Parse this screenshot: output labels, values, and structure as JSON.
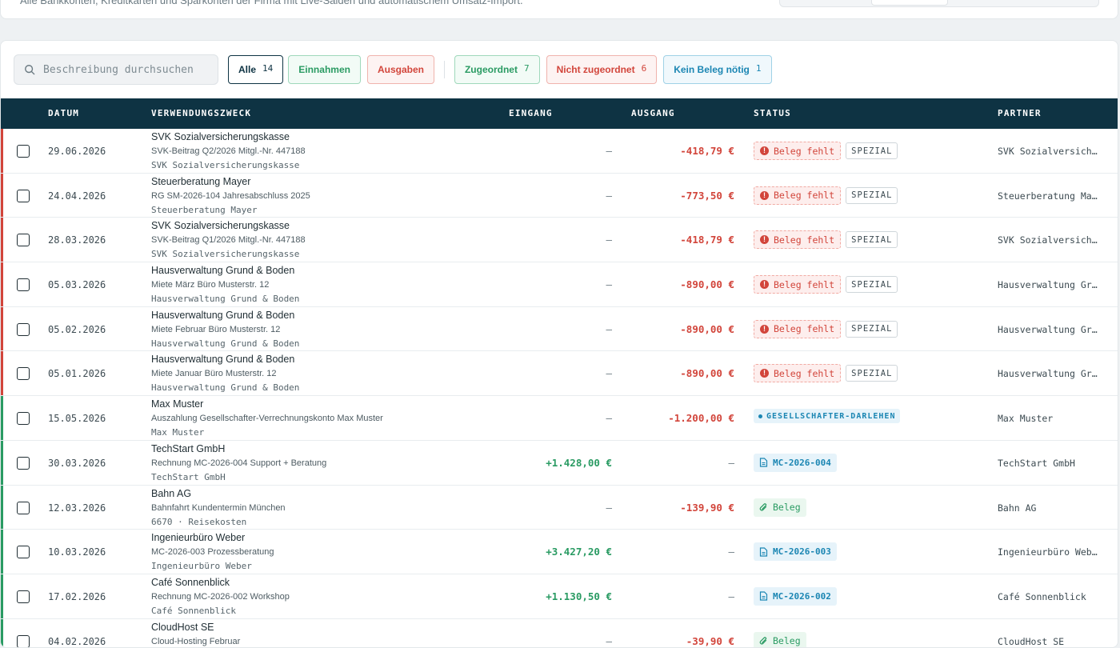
{
  "top": {
    "subtitle": "Alle Bankkonten, Kreditkarten und Sparkonten der Firma mit Live-Salden und automatischem Umsatz-Import."
  },
  "search": {
    "placeholder": "Beschreibung durchsuchen"
  },
  "filters": {
    "all": {
      "label": "Alle",
      "count": "14"
    },
    "income": {
      "label": "Einnahmen"
    },
    "expenses": {
      "label": "Ausgaben"
    },
    "assigned": {
      "label": "Zugeordnet",
      "count": "7"
    },
    "unassigned": {
      "label": "Nicht zugeordnet",
      "count": "6"
    },
    "no_receipt": {
      "label": "Kein Beleg nötig",
      "count": "1"
    }
  },
  "columns": {
    "date": "DATUM",
    "purpose": "VERWENDUNGSZWECK",
    "income": "EINGANG",
    "expense": "AUSGANG",
    "status": "STATUS",
    "partner": "PARTNER"
  },
  "colors": {
    "header_bg": "#0e3343",
    "positive": "#2a9b63",
    "negative": "#d2453b",
    "info": "#1b86b3"
  },
  "rows": [
    {
      "indicator": "red",
      "date": "29.06.2026",
      "title": "SVK Sozialversicherungskasse",
      "detail": "SVK-Beitrag Q2/2026 Mitgl.-Nr. 447188",
      "sub": "SVK Sozialversicherungskasse",
      "income": "–",
      "expense": "-418,79 €",
      "status": "missing",
      "status_label": "Beleg fehlt",
      "tag": "SPEZIAL",
      "partner": "SVK Sozialversicherungskasse"
    },
    {
      "indicator": "red",
      "date": "24.04.2026",
      "title": "Steuerberatung Mayer",
      "detail": "RG SM-2026-104 Jahresabschluss 2025",
      "sub": "Steuerberatung Mayer",
      "income": "–",
      "expense": "-773,50 €",
      "status": "missing",
      "status_label": "Beleg fehlt",
      "tag": "SPEZIAL",
      "partner": "Steuerberatung Mayer"
    },
    {
      "indicator": "red",
      "date": "28.03.2026",
      "title": "SVK Sozialversicherungskasse",
      "detail": "SVK-Beitrag Q1/2026 Mitgl.-Nr. 447188",
      "sub": "SVK Sozialversicherungskasse",
      "income": "–",
      "expense": "-418,79 €",
      "status": "missing",
      "status_label": "Beleg fehlt",
      "tag": "SPEZIAL",
      "partner": "SVK Sozialversicherungskasse"
    },
    {
      "indicator": "red",
      "date": "05.03.2026",
      "title": "Hausverwaltung Grund & Boden",
      "detail": "Miete März Büro Musterstr. 12",
      "sub": "Hausverwaltung Grund & Boden",
      "income": "–",
      "expense": "-890,00 €",
      "status": "missing",
      "status_label": "Beleg fehlt",
      "tag": "SPEZIAL",
      "partner": "Hausverwaltung Grund & Boden"
    },
    {
      "indicator": "red",
      "date": "05.02.2026",
      "title": "Hausverwaltung Grund & Boden",
      "detail": "Miete Februar Büro Musterstr. 12",
      "sub": "Hausverwaltung Grund & Boden",
      "income": "–",
      "expense": "-890,00 €",
      "status": "missing",
      "status_label": "Beleg fehlt",
      "tag": "SPEZIAL",
      "partner": "Hausverwaltung Grund & Boden"
    },
    {
      "indicator": "red",
      "date": "05.01.2026",
      "title": "Hausverwaltung Grund & Boden",
      "detail": "Miete Januar Büro Musterstr. 12",
      "sub": "Hausverwaltung Grund & Boden",
      "income": "–",
      "expense": "-890,00 €",
      "status": "missing",
      "status_label": "Beleg fehlt",
      "tag": "SPEZIAL",
      "partner": "Hausverwaltung Grund & Boden"
    },
    {
      "indicator": "green",
      "date": "15.05.2026",
      "title": "Max Muster",
      "detail": "Auszahlung Gesellschafter-Verrechnungskonto Max Muster",
      "sub": "Max Muster",
      "income": "–",
      "expense": "-1.200,00 €",
      "status": "darlehen",
      "status_label": "GESELLSCHAFTER-DARLEHEN",
      "tag": "",
      "partner": "Max Muster"
    },
    {
      "indicator": "green",
      "date": "30.03.2026",
      "title": "TechStart GmbH",
      "detail": "Rechnung MC-2026-004 Support + Beratung",
      "sub": "TechStart GmbH",
      "income": "+1.428,00 €",
      "expense": "–",
      "status": "doc",
      "status_label": "MC-2026-004",
      "tag": "",
      "partner": "TechStart GmbH"
    },
    {
      "indicator": "green",
      "date": "12.03.2026",
      "title": "Bahn AG",
      "detail": "Bahnfahrt Kundentermin München",
      "sub": "6670 · Reisekosten",
      "income": "–",
      "expense": "-139,90 €",
      "status": "beleg",
      "status_label": "Beleg",
      "tag": "",
      "partner": "Bahn AG"
    },
    {
      "indicator": "green",
      "date": "10.03.2026",
      "title": "Ingenieurbüro Weber",
      "detail": "MC-2026-003 Prozessberatung",
      "sub": "Ingenieurbüro Weber",
      "income": "+3.427,20 €",
      "expense": "–",
      "status": "doc",
      "status_label": "MC-2026-003",
      "tag": "",
      "partner": "Ingenieurbüro Weber"
    },
    {
      "indicator": "green",
      "date": "17.02.2026",
      "title": "Café Sonnenblick",
      "detail": "Rechnung MC-2026-002 Workshop",
      "sub": "Café Sonnenblick",
      "income": "+1.130,50 €",
      "expense": "–",
      "status": "doc",
      "status_label": "MC-2026-002",
      "tag": "",
      "partner": "Café Sonnenblick"
    },
    {
      "indicator": "green",
      "date": "04.02.2026",
      "title": "CloudHost SE",
      "detail": "Cloud-Hosting Februar",
      "sub": "",
      "income": "–",
      "expense": "-39,90 €",
      "status": "beleg",
      "status_label": "Beleg",
      "tag": "",
      "partner": "CloudHost SE"
    }
  ]
}
